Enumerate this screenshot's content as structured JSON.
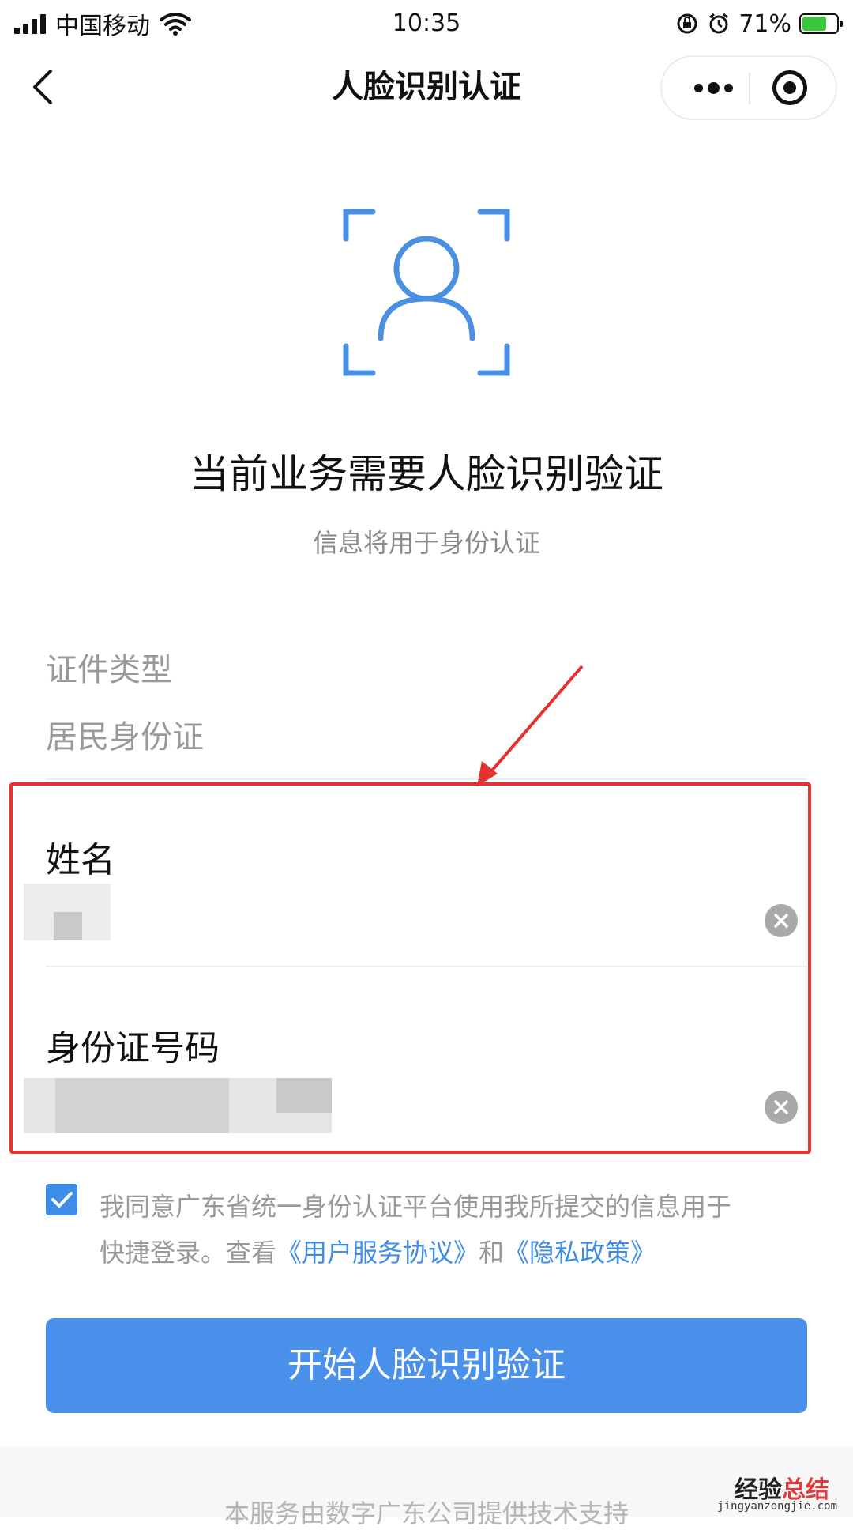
{
  "status_bar": {
    "carrier": "中国移动",
    "time": "10:35",
    "battery_percent": "71%",
    "battery_level": 0.71
  },
  "nav": {
    "title": "人脸识别认证",
    "back_icon": "chevron-left-icon",
    "more_icon": "more-dots-icon",
    "close_icon": "target-icon"
  },
  "main": {
    "face_icon": "face-scan-icon",
    "heading": "当前业务需要人脸识别验证",
    "subheading": "信息将用于身份认证"
  },
  "form": {
    "doc_type_label": "证件类型",
    "doc_type_value": "居民身份证",
    "name_label": "姓名",
    "id_label": "身份证号码",
    "highlight_color": "#e63131"
  },
  "agreement": {
    "checked": true,
    "text_1": "我同意广东省统一身份认证平台使用我所提交的信息用于",
    "text_2": "快捷登录。查看",
    "link_terms": "《用户服务协议》",
    "conj": "和",
    "link_privacy": "《隐私政策》"
  },
  "button": {
    "label": "开始人脸识别验证",
    "color": "#4990ea"
  },
  "footer": {
    "text": "本服务由数字广东公司提供技术支持"
  },
  "watermark": {
    "part1": "经验",
    "part2": "总结",
    "url": "jingyanzongjie.com"
  }
}
